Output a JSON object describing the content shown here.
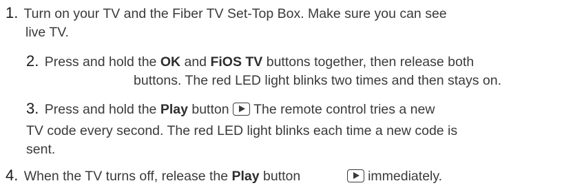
{
  "steps": [
    {
      "number": "1.",
      "line1": "Turn on your TV and the Fiber TV Set-Top Box. Make sure you can see",
      "line2": "live TV."
    },
    {
      "number": "2.",
      "pre": "Press and hold the",
      "bold1": "OK",
      "mid": "and",
      "bold2": "FiOS TV",
      "post": "buttons together, then release both",
      "line2": "buttons. The red LED light blinks two times and then stays on."
    },
    {
      "number": "3.",
      "pre": "Press and hold the",
      "bold": "Play",
      "post_before_icon": "button",
      "icon": "play-button-icon",
      "post_after_icon": "The remote control tries a new",
      "line2": "TV code every second. The red LED light blinks each time a new code is",
      "line3": "sent."
    },
    {
      "number": "4.",
      "pre": "When the TV turns off, release the",
      "bold": "Play",
      "post_before_icon": "button",
      "icon": "play-button-icon",
      "post_after_icon": "immediately."
    }
  ]
}
